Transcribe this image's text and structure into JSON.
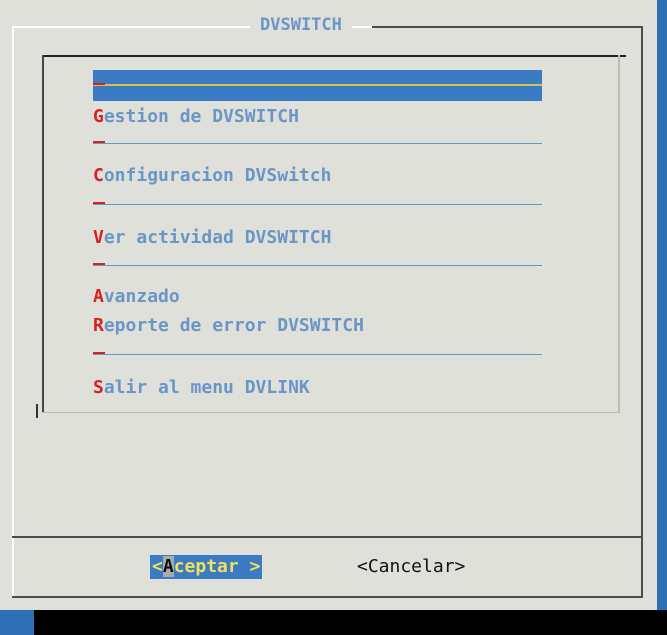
{
  "dialog": {
    "title": "DVSWITCH"
  },
  "menu": {
    "items": [
      {
        "hotkey": "G",
        "rest": "estion de DVSWITCH"
      },
      {
        "hotkey": "C",
        "rest": "onfiguracion DVSwitch"
      },
      {
        "hotkey": "V",
        "rest": "er actividad DVSWITCH"
      },
      {
        "hotkey": "A",
        "rest": "vanzado"
      },
      {
        "hotkey": "R",
        "rest": "eporte de error DVSWITCH"
      },
      {
        "hotkey": "S",
        "rest": "alir al menu DVLINK"
      }
    ]
  },
  "buttons": {
    "accept_prefix": "<",
    "accept_hotkey": "A",
    "accept_rest": "ceptar >",
    "cancel_label": "<Cancelar>"
  },
  "colors": {
    "screen_bg": "#2e6fb5",
    "dialog_bg": "#e0e0da",
    "item_text": "#6a95c7",
    "hotkey": "#d92020",
    "selection": "#3b7ac4",
    "button_highlight": "#f2e05a"
  }
}
